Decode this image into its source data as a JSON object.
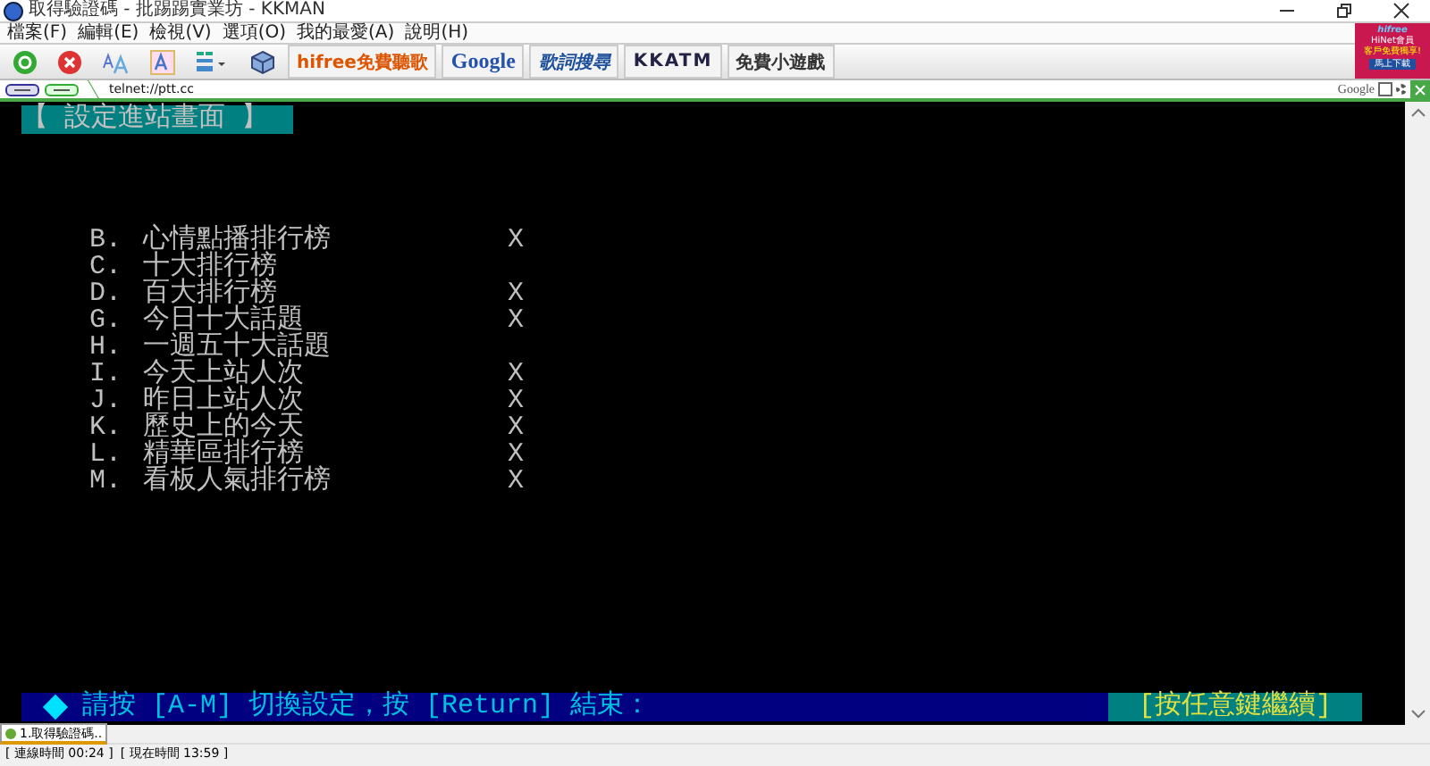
{
  "window": {
    "title": "取得驗證碼 - 批踢踢實業坊 - KKMAN"
  },
  "menu": [
    "檔案(F)",
    "編輯(E)",
    "檢視(V)",
    "選項(O)",
    "我的最愛(A)",
    "說明(H)"
  ],
  "toolbar": [
    {
      "kind": "go"
    },
    {
      "kind": "stop"
    },
    {
      "kind": "font-size"
    },
    {
      "kind": "font"
    },
    {
      "kind": "layout"
    },
    {
      "kind": "cube"
    },
    {
      "kind": "logo",
      "text": "hifree免費聽歌"
    },
    {
      "kind": "logo",
      "text": "Google"
    },
    {
      "kind": "logo",
      "text": "歌詞搜尋"
    },
    {
      "kind": "logo",
      "text": "KKATM"
    },
    {
      "kind": "logo",
      "text": "免費小遊戲"
    }
  ],
  "ad": {
    "brand": "hifree",
    "line1": "HiNet會員",
    "line2": "客戶免費獨享!",
    "button": "馬上下載"
  },
  "address": {
    "value": "telnet://ptt.cc",
    "search_label": "Google"
  },
  "terminal": {
    "header": "【 設定進站畫面 】",
    "items": [
      {
        "key": "B.",
        "label": "心情點播排行榜",
        "mark": "X"
      },
      {
        "key": "C.",
        "label": "十大排行榜"
      },
      {
        "key": "D.",
        "label": "百大排行榜",
        "mark": "X"
      },
      {
        "key": "G.",
        "label": "今日十大話題",
        "mark": "X"
      },
      {
        "key": "H.",
        "label": "一週五十大話題"
      },
      {
        "key": "I.",
        "label": "今天上站人次",
        "mark": "X"
      },
      {
        "key": "J.",
        "label": "昨日上站人次",
        "mark": "X"
      },
      {
        "key": "K.",
        "label": "歷史上的今天",
        "mark": "X"
      },
      {
        "key": "L.",
        "label": "精華區排行榜",
        "mark": "X"
      },
      {
        "key": "M.",
        "label": "看板人氣排行榜",
        "mark": "X"
      }
    ],
    "prompt": "請按 [A-M] 切換設定，按 [Return] 結束：",
    "continue": "[按任意鍵繼續]"
  },
  "taskbar": [
    {
      "label": "1.取得驗證碼..",
      "selected": true
    }
  ],
  "status": [
    "[ 連線時間 00:24 ]",
    "[ 現在時間 13:59 ]"
  ]
}
